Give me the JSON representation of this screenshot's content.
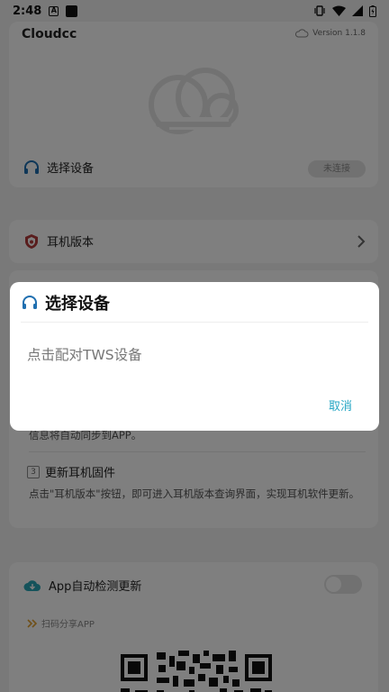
{
  "status_bar": {
    "time": "2:48"
  },
  "header": {
    "app_name": "Cloudcc",
    "version": "Version 1.1.8"
  },
  "device": {
    "select_label": "选择设备",
    "connect_button": "未连接"
  },
  "version_row": {
    "label": "耳机版本"
  },
  "steps": {
    "step2_tail": "信息将自动同步到APP。",
    "step3_number": "3",
    "step3_title": "更新耳机固件",
    "step3_desc": "点击\"耳机版本\"按钮，即可进入耳机版本查询界面，实现耳机软件更新。"
  },
  "auto_update": {
    "label": "App自动检测更新",
    "share_label": "扫码分享APP"
  },
  "dialog": {
    "title": "选择设备",
    "message": "点击配对TWS设备",
    "cancel": "取消"
  },
  "colors": {
    "accent": "#26a6c4",
    "headphone_icon": "#1f6fb0",
    "shield_icon": "#b23a3a",
    "cloud_icon": "#2aa6b6"
  }
}
